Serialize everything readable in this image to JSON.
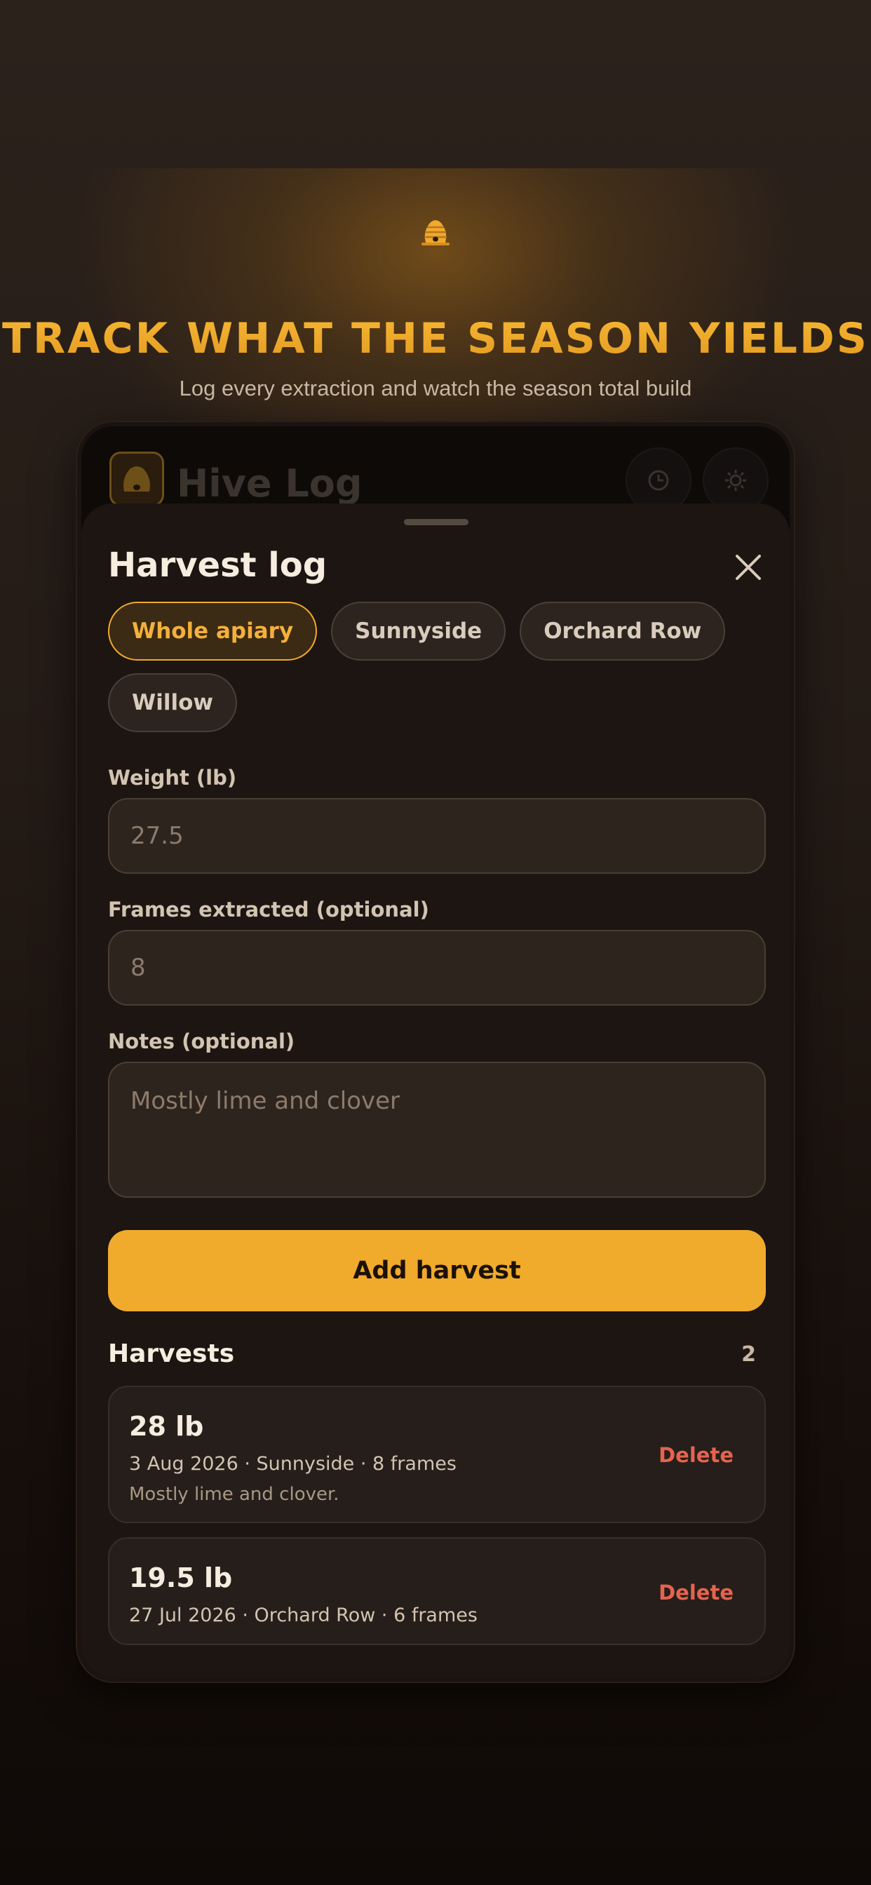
{
  "hero": {
    "icon": "beehive-icon",
    "title": "TRACK WHAT THE SEASON YIELDS",
    "subtitle": "Log every extraction and watch the season total build"
  },
  "app": {
    "title": "Hive Log",
    "logo_icon": "beehive-icon",
    "history_icon": "clock-icon",
    "settings_icon": "gear-icon"
  },
  "sheet": {
    "title": "Harvest log",
    "close_icon": "close-icon",
    "filters": [
      {
        "label": "Whole apiary",
        "selected": true
      },
      {
        "label": "Sunnyside",
        "selected": false
      },
      {
        "label": "Orchard Row",
        "selected": false
      },
      {
        "label": "Willow",
        "selected": false
      }
    ],
    "weight": {
      "label": "Weight (lb)",
      "placeholder": "27.5",
      "value": ""
    },
    "frames": {
      "label": "Frames extracted (optional)",
      "placeholder": "8",
      "value": ""
    },
    "notes": {
      "label": "Notes (optional)",
      "placeholder": "Mostly lime and clover",
      "value": ""
    },
    "submit_label": "Add harvest"
  },
  "harvests": {
    "title": "Harvests",
    "count": "2",
    "items": [
      {
        "weight": "28 lb",
        "meta": "3 Aug 2026  ·  Sunnyside  ·  8 frames",
        "note": "Mostly lime and clover.",
        "delete_label": "Delete"
      },
      {
        "weight": "19.5 lb",
        "meta": "27 Jul 2026  ·  Orchard Row  ·  6 frames",
        "note": "",
        "delete_label": "Delete"
      }
    ]
  },
  "colors": {
    "accent": "#f0aa2c",
    "danger": "#e5634f",
    "sheet_bg": "#1c1512"
  }
}
